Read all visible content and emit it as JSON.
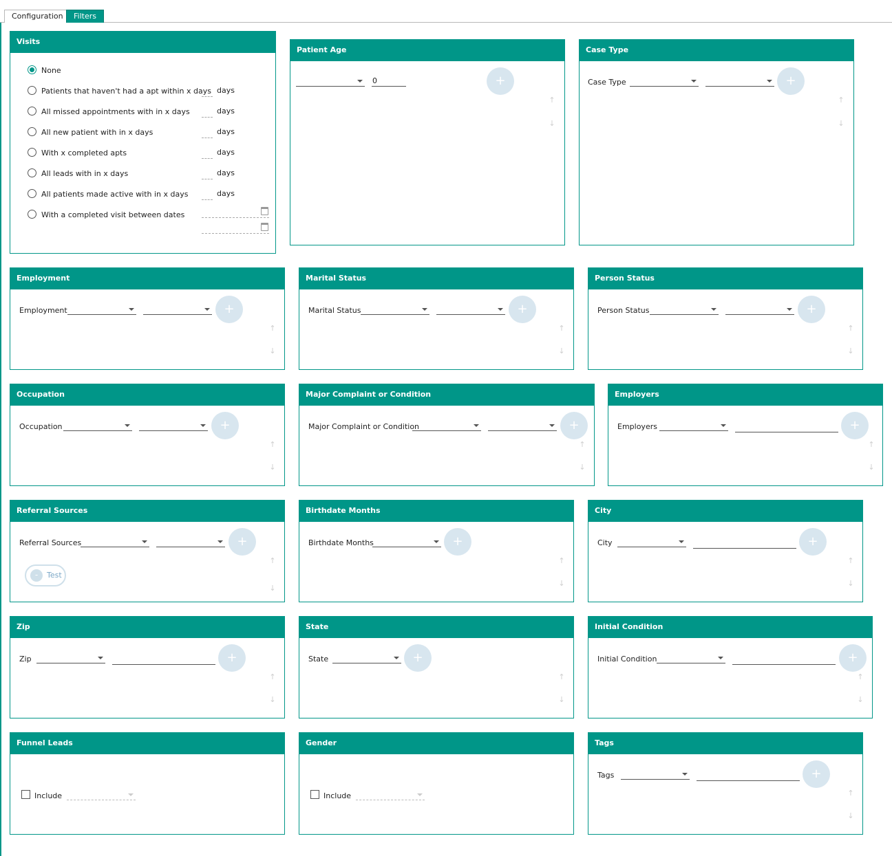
{
  "tabs": [
    {
      "label": "Configuration",
      "active": false
    },
    {
      "label": "Filters",
      "active": true
    }
  ],
  "colors": {
    "accent": "#009688",
    "add_button": "#d8e6ef"
  },
  "visits": {
    "title": "Visits",
    "selected": "None",
    "options": [
      {
        "label": "None"
      },
      {
        "label": "Patients that haven't had a apt within x days",
        "unit": "days"
      },
      {
        "label": "All missed appointments with in x days",
        "unit": "days"
      },
      {
        "label": "All new patient with in x days",
        "unit": "days"
      },
      {
        "label": "With x completed apts",
        "unit": "days"
      },
      {
        "label": "All leads with in x days",
        "unit": "days"
      },
      {
        "label": "All patients made active with in x days",
        "unit": "days"
      },
      {
        "label": "With a completed visit between dates"
      }
    ]
  },
  "patient_age": {
    "title": "Patient Age",
    "operator": "",
    "value": "0"
  },
  "case_type": {
    "title": "Case Type",
    "label": "Case Type"
  },
  "employment": {
    "title": "Employment",
    "label": "Employment"
  },
  "marital_status": {
    "title": "Marital Status",
    "label": "Marital Status"
  },
  "person_status": {
    "title": "Person Status",
    "label": "Person Status"
  },
  "occupation": {
    "title": "Occupation",
    "label": "Occupation"
  },
  "major_complaint": {
    "title": "Major Complaint or Condition",
    "label": "Major Complaint or Condition"
  },
  "employers": {
    "title": "Employers",
    "label": "Employers"
  },
  "referral_sources": {
    "title": "Referral Sources",
    "label": "Referral Sources",
    "chips": [
      "Test"
    ]
  },
  "birthdate_months": {
    "title": "Birthdate Months",
    "label": "Birthdate Months"
  },
  "city": {
    "title": "City",
    "label": "City"
  },
  "zip": {
    "title": "Zip",
    "label": "Zip"
  },
  "state": {
    "title": "State",
    "label": "State"
  },
  "initial_condition": {
    "title": "Initial Condition",
    "label": "Initial Condition"
  },
  "funnel_leads": {
    "title": "Funnel Leads",
    "include_label": "Include",
    "checked": false
  },
  "gender": {
    "title": "Gender",
    "include_label": "Include",
    "checked": false
  },
  "tags": {
    "title": "Tags",
    "label": "Tags"
  },
  "icons": {
    "add": "plus-icon",
    "up": "arrow-up-icon",
    "down": "arrow-down-icon",
    "remove": "minus-icon",
    "calendar": "calendar-icon",
    "dropdown": "chevron-down-icon"
  }
}
